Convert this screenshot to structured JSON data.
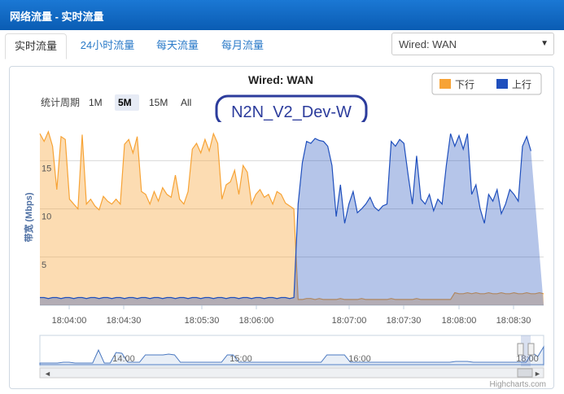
{
  "window": {
    "title": "网络流量 - 实时流量"
  },
  "tabs": [
    {
      "label": "实时流量",
      "active": true
    },
    {
      "label": "24小时流量",
      "active": false
    },
    {
      "label": "每天流量",
      "active": false
    },
    {
      "label": "每月流量",
      "active": false
    }
  ],
  "interface_select": {
    "value": "Wired: WAN"
  },
  "chart": {
    "title": "Wired: WAN",
    "period_label": "统计周期",
    "periods": [
      {
        "label": "1M",
        "selected": false
      },
      {
        "label": "5M",
        "selected": true
      },
      {
        "label": "15M",
        "selected": false
      },
      {
        "label": "All",
        "selected": false
      }
    ],
    "annotation": "N2N_V2_Dev-W",
    "credit": "Highcharts.com"
  },
  "chart_data": {
    "type": "area",
    "title": "Wired: WAN",
    "ylabel": "带宽 (Mbps)",
    "ylim": [
      0,
      19
    ],
    "yticks": [
      "5",
      "10",
      "15"
    ],
    "xticks": [
      "18:04:00",
      "18:04:30",
      "18:05:30",
      "18:06:00",
      "18:07:00",
      "18:07:30",
      "18:08:00",
      "18:08:30"
    ],
    "legend_position": "top-right",
    "grid": true,
    "colors": {
      "下行": "#f7a335",
      "上行": "#1f4fbd"
    },
    "series": [
      {
        "name": "下行",
        "values": [
          17.8,
          17.0,
          18.0,
          16.5,
          12.0,
          17.5,
          17.2,
          11.0,
          10.5,
          10.0,
          17.7,
          10.5,
          11.0,
          10.3,
          9.9,
          11.3,
          10.8,
          10.5,
          11.0,
          10.5,
          16.7,
          17.2,
          15.8,
          17.5,
          11.8,
          11.5,
          10.5,
          11.8,
          10.8,
          12.2,
          11.5,
          11.2,
          13.5,
          11.0,
          10.5,
          11.8,
          16.2,
          16.8,
          15.8,
          17.2,
          16.0,
          17.8,
          16.8,
          11.0,
          12.5,
          12.8,
          14.0,
          11.5,
          14.5,
          13.8,
          10.5,
          11.5,
          12.0,
          11.2,
          11.5,
          10.5,
          11.8,
          11.5,
          10.6,
          10.3,
          10.0,
          0.6,
          0.6,
          0.7,
          0.7,
          0.6,
          0.7,
          0.6,
          0.6,
          0.6,
          0.6,
          0.7,
          0.6,
          0.6,
          0.6,
          0.6,
          0.7,
          0.6,
          0.6,
          0.6,
          0.6,
          0.6,
          0.6,
          0.7,
          0.6,
          0.6,
          0.6,
          0.6,
          0.6,
          0.7,
          0.6,
          0.6,
          0.6,
          0.6,
          0.6,
          0.6,
          0.6,
          0.6,
          1.3,
          1.2,
          1.2,
          1.3,
          1.2,
          1.3,
          1.2,
          1.2,
          1.3,
          1.2,
          1.2,
          1.3,
          1.2,
          1.2,
          1.3,
          1.2,
          1.2,
          1.3,
          1.2,
          1.2,
          1.3,
          1.2
        ]
      },
      {
        "name": "上行",
        "values": [
          0.8,
          0.8,
          0.7,
          0.8,
          0.8,
          0.7,
          0.8,
          0.8,
          0.7,
          0.8,
          0.8,
          0.7,
          0.8,
          0.8,
          0.7,
          0.8,
          0.8,
          0.7,
          0.8,
          0.8,
          0.7,
          0.8,
          0.8,
          0.7,
          0.8,
          0.8,
          0.7,
          0.8,
          0.8,
          0.7,
          0.8,
          0.8,
          0.7,
          0.8,
          0.8,
          0.7,
          0.8,
          0.8,
          0.7,
          0.8,
          0.8,
          0.7,
          0.8,
          0.8,
          0.7,
          0.8,
          0.8,
          0.7,
          0.8,
          0.8,
          0.7,
          0.8,
          0.8,
          0.7,
          0.8,
          0.8,
          0.7,
          0.8,
          0.8,
          0.7,
          0.8,
          10.5,
          14.8,
          17.0,
          16.8,
          17.3,
          17.1,
          17.0,
          16.5,
          14.5,
          9.2,
          12.5,
          8.5,
          10.5,
          11.8,
          9.6,
          10.0,
          10.5,
          11.2,
          10.2,
          9.8,
          10.3,
          10.5,
          17.0,
          16.5,
          17.2,
          16.8,
          13.5,
          10.5,
          15.5,
          11.0,
          10.5,
          11.5,
          9.8,
          11.0,
          10.5,
          14.5,
          17.8,
          16.5,
          17.6,
          16.2,
          17.8,
          11.5,
          12.5,
          10.0,
          8.5,
          11.5,
          10.8,
          12.0,
          9.5,
          10.5,
          12.0,
          11.5,
          10.8,
          16.5,
          17.5,
          16.0
        ]
      }
    ],
    "navigator_xticks": [
      "14:00",
      "15:00",
      "16:00",
      "18:00"
    ]
  }
}
